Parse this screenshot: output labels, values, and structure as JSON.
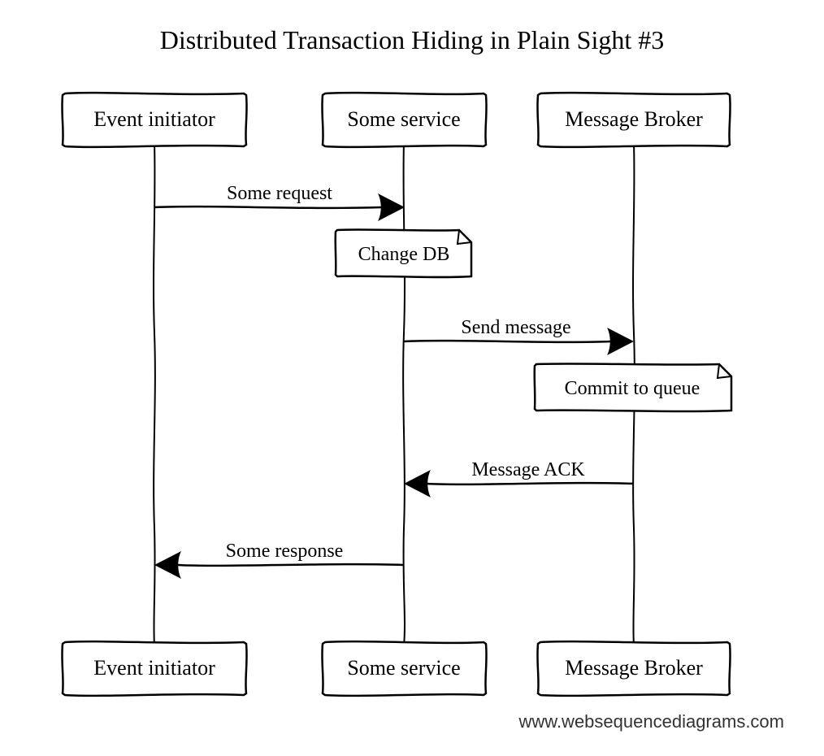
{
  "title": "Distributed Transaction Hiding in Plain Sight #3",
  "actors": {
    "a1": "Event initiator",
    "a2": "Some service",
    "a3": "Message Broker"
  },
  "messages": {
    "m1": "Some request",
    "m2": "Send message",
    "m3": "Message ACK",
    "m4": "Some response"
  },
  "notes": {
    "n1": "Change DB",
    "n2": "Commit to queue"
  },
  "credit": "www.websequencediagrams.com"
}
